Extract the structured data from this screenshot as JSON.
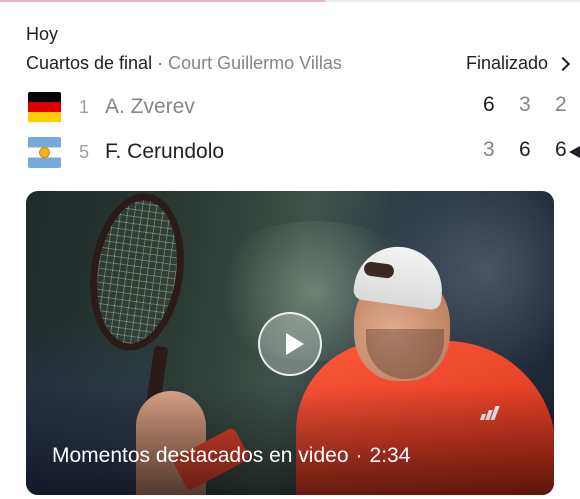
{
  "header": {
    "day": "Hoy",
    "round": "Cuartos de final",
    "separator": "·",
    "court": "Court Guillermo Villas",
    "status": "Finalizado"
  },
  "players": [
    {
      "seed": "1",
      "name": "A. Zverev",
      "flag": "germany-flag",
      "scores": [
        "6",
        "3",
        "2"
      ]
    },
    {
      "seed": "5",
      "name": "F. Cerundolo",
      "flag": "argentina-flag",
      "scores": [
        "3",
        "6",
        "6"
      ]
    }
  ],
  "video": {
    "title": "Momentos destacados en video",
    "separator": "·",
    "duration": "2:34"
  },
  "icons": {
    "status": "chevron-right-icon",
    "winner": "winner-indicator-icon",
    "video": "play-icon"
  },
  "colors": {
    "shirt": "#e23d24",
    "text": "#202124",
    "muted": "#80868b"
  }
}
